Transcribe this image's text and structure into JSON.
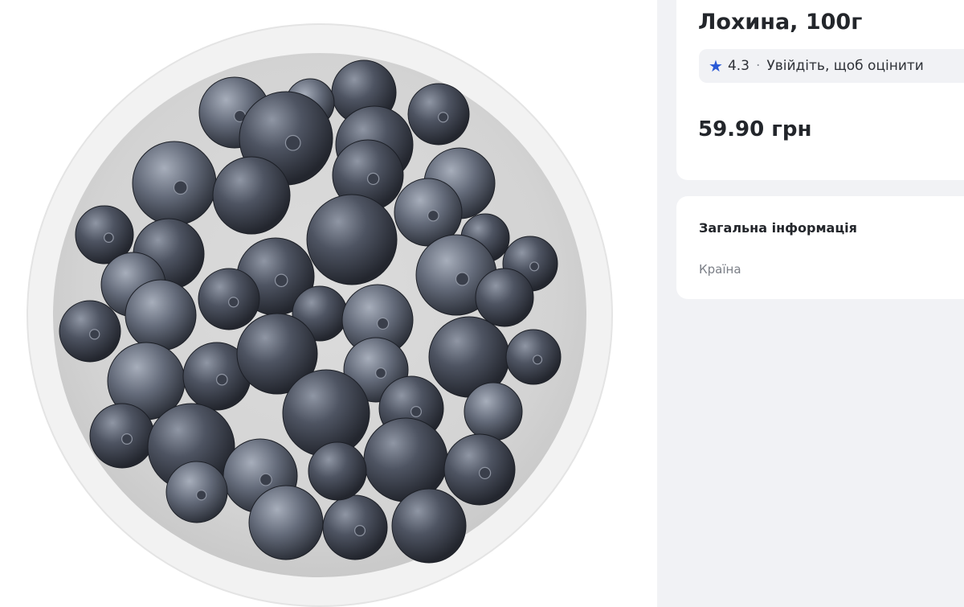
{
  "product": {
    "title": "Лохина, 100г",
    "rating": "4.3",
    "rating_separator": "·",
    "rating_cta": "Увійдіть, щоб оцінити",
    "price": "59.90 грн",
    "image_alt": "blueberries-in-bowl"
  },
  "info": {
    "heading": "Загальна інформація",
    "country_label": "Країна"
  },
  "colors": {
    "panel_background": "#f1f2f5",
    "card_background": "#ffffff",
    "star_accent": "#2a5ad6",
    "text_primary": "#23262b",
    "text_muted": "#7b7f87"
  },
  "icons": {
    "rating": "star-icon"
  }
}
